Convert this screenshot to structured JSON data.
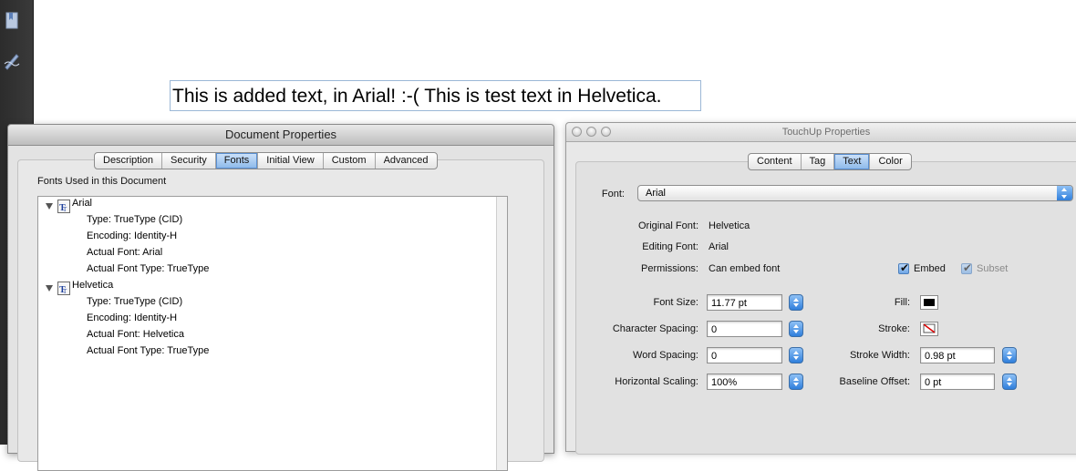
{
  "document": {
    "added_text": "This is added text, in Arial! :-( This is test text in Helvetica."
  },
  "left_toolbar": {
    "icons": [
      "bookmark-page-icon",
      "signature-pen-icon"
    ]
  },
  "document_properties": {
    "title": "Document Properties",
    "tabs": [
      "Description",
      "Security",
      "Fonts",
      "Initial View",
      "Custom",
      "Advanced"
    ],
    "active_tab": "Fonts",
    "group_label": "Fonts Used in this Document",
    "fonts": [
      {
        "name": "Arial",
        "details": [
          "Type: TrueType (CID)",
          "Encoding: Identity-H",
          "Actual Font: Arial",
          "Actual Font Type: TrueType"
        ]
      },
      {
        "name": "Helvetica",
        "details": [
          "Type: TrueType (CID)",
          "Encoding: Identity-H",
          "Actual Font: Helvetica",
          "Actual Font Type: TrueType"
        ]
      }
    ]
  },
  "touchup": {
    "title": "TouchUp Properties",
    "tabs": [
      "Content",
      "Tag",
      "Text",
      "Color"
    ],
    "active_tab": "Text",
    "font_label": "Font:",
    "font_value": "Arial",
    "original_font_label": "Original Font:",
    "original_font_value": "Helvetica",
    "editing_font_label": "Editing Font:",
    "editing_font_value": "Arial",
    "permissions_label": "Permissions:",
    "permissions_value": "Can embed font",
    "embed_label": "Embed",
    "embed_checked": true,
    "subset_label": "Subset",
    "subset_checked": true,
    "font_size_label": "Font Size:",
    "font_size_value": "11.77 pt",
    "char_spacing_label": "Character Spacing:",
    "char_spacing_value": "0",
    "word_spacing_label": "Word Spacing:",
    "word_spacing_value": "0",
    "h_scaling_label": "Horizontal Scaling:",
    "h_scaling_value": "100%",
    "fill_label": "Fill:",
    "fill_color": "#000000",
    "stroke_label": "Stroke:",
    "stroke_width_label": "Stroke Width:",
    "stroke_width_value": "0.98 pt",
    "baseline_label": "Baseline Offset:",
    "baseline_value": "0 pt"
  }
}
